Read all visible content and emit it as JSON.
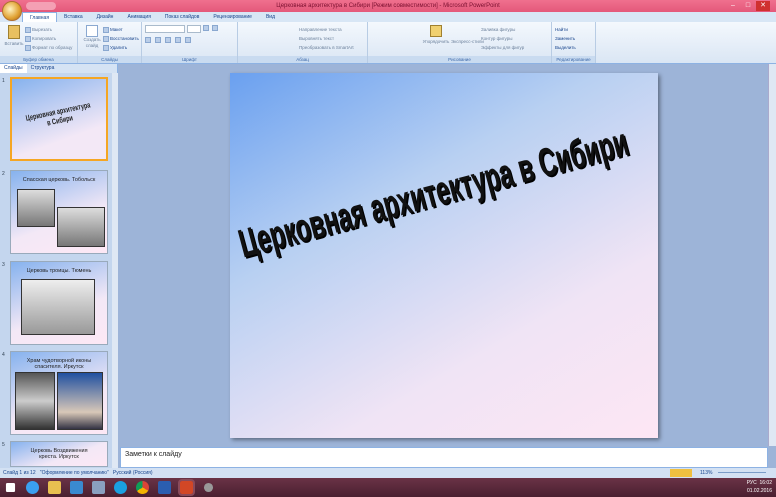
{
  "window": {
    "title": "Церковная архитектура в  Сибири [Режим совместимости] - Microsoft PowerPoint",
    "minimize": "–",
    "maximize": "□",
    "close": "✕"
  },
  "tabs": [
    "Главная",
    "Вставка",
    "Дизайн",
    "Анимация",
    "Показ слайдов",
    "Рецензирование",
    "Вид"
  ],
  "ribbon": {
    "clipboard": {
      "label": "Буфер обмена",
      "paste": "Вставить",
      "cut": "Вырезать",
      "copy": "Копировать",
      "format": "Формат по образцу"
    },
    "slides": {
      "label": "Слайды",
      "new": "Создать слайд",
      "layout": "Макет",
      "reset": "Восстановить",
      "delete": "Удалить"
    },
    "font": {
      "label": "Шрифт"
    },
    "paragraph": {
      "label": "Абзац",
      "direction": "Направление текста",
      "align": "Выровнять текст",
      "smartart": "Преобразовать в SmartArt"
    },
    "drawing": {
      "label": "Рисование",
      "arrange": "Упорядочить",
      "styles": "Экспресс-стили",
      "fill": "Заливка фигуры",
      "outline": "Контур фигуры",
      "effects": "Эффекты для фигур"
    },
    "editing": {
      "label": "Редактирование",
      "find": "Найти",
      "replace": "Заменить",
      "select": "Выделить"
    }
  },
  "panel": {
    "tabs": [
      "Слайды",
      "Структура"
    ],
    "slides": [
      {
        "num": "1",
        "title": "Церковная архитектура в Сибири"
      },
      {
        "num": "2",
        "title": "Спасская церковь. Тобольск"
      },
      {
        "num": "3",
        "title": "Церковь троицы. Тюмень"
      },
      {
        "num": "4",
        "title": "Храм чудотворной иконы спасителя. Иркутск"
      },
      {
        "num": "5",
        "title": "Церковь Воздвижения креста. Иркутск"
      }
    ]
  },
  "slide": {
    "title": "Церковная архитектура в  Сибири"
  },
  "notes": {
    "placeholder": "Заметки к слайду"
  },
  "status": {
    "slide": "Слайд 1 из 12",
    "theme": "\"Оформление по умолчанию\"",
    "lang": "Русский (Россия)",
    "zoom": "113%"
  },
  "taskbar": {
    "lang": "РУС",
    "time": "16:02",
    "date": "01.02.2016"
  }
}
